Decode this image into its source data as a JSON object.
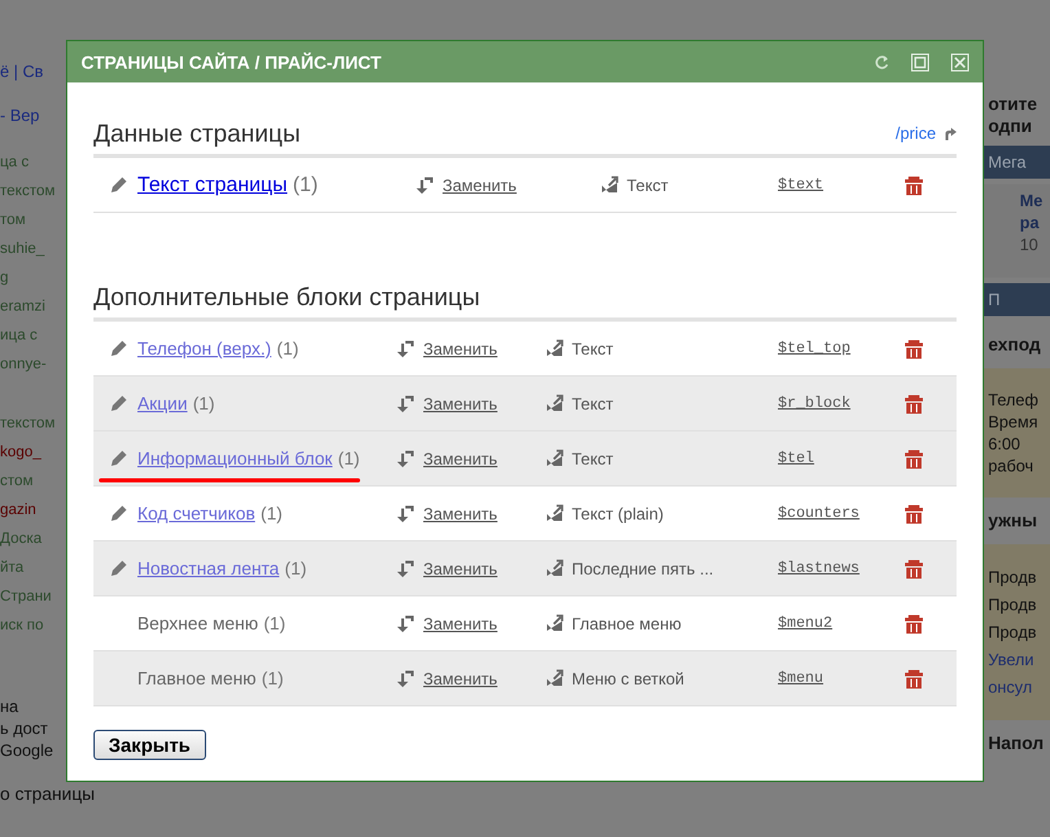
{
  "background": {
    "left": [
      {
        "text": "ё | Св",
        "kind": "link"
      },
      {
        "text": "- Вер",
        "kind": "link"
      },
      {
        "text": "ца с",
        "kind": "green"
      },
      {
        "text": "текстом",
        "kind": "green"
      },
      {
        "text": "том",
        "kind": "green"
      },
      {
        "text": "suhie_",
        "kind": "green"
      },
      {
        "text": "g",
        "kind": "green"
      },
      {
        "text": "eramzi",
        "kind": "green"
      },
      {
        "text": "ица с",
        "kind": "green"
      },
      {
        "text": "onnye-",
        "kind": "green"
      },
      {
        "kind": "gap"
      },
      {
        "text": "текстом",
        "kind": "green"
      },
      {
        "text": "kogo_",
        "kind": "red"
      },
      {
        "text": "стом",
        "kind": "green"
      },
      {
        "text": "gazin",
        "kind": "red"
      },
      {
        "text": "Доска",
        "kind": "green"
      },
      {
        "text": "йта",
        "kind": "green"
      },
      {
        "text": "Страни",
        "kind": "green"
      },
      {
        "text": "иск по",
        "kind": "green"
      }
    ],
    "left_bottom": [
      "на",
      "ь дост",
      "Google"
    ],
    "left_footer": "о страницы",
    "right": [
      {
        "kind": "title",
        "lines": [
          "отите",
          "одпи"
        ]
      },
      {
        "kind": "band",
        "lines": [
          "Мега"
        ]
      },
      {
        "kind": "promo",
        "lines": [
          "Ме",
          "ра",
          "10"
        ]
      },
      {
        "kind": "band",
        "lines": [
          "П"
        ]
      },
      {
        "kind": "header",
        "lines": [
          "ехпод"
        ]
      },
      {
        "kind": "note",
        "lines": [
          "Телеф",
          "Время",
          "6:00",
          "рабоч"
        ]
      },
      {
        "kind": "header",
        "lines": [
          "ужны"
        ]
      },
      {
        "kind": "list",
        "lines": [
          "Продв",
          "Продв",
          "Продв"
        ],
        "links": [
          "Увели",
          "онсул"
        ]
      },
      {
        "kind": "header",
        "lines": [
          "Напол"
        ]
      }
    ]
  },
  "dialog": {
    "title": "СТРАНИЦЫ САЙТА / ПРАЙС-ЛИСТ",
    "sections": [
      {
        "kind": "main",
        "heading": "Данные страницы",
        "link": "/price",
        "rows": [
          {
            "name": "Текст страницы",
            "count": "(1)",
            "editable": true,
            "shaded": false,
            "annotated": false,
            "action": "Заменить",
            "type": "Текст",
            "variable": "$text"
          }
        ]
      },
      {
        "kind": "extra",
        "heading": "Дополнительные блоки страницы",
        "rows": [
          {
            "name": "Телефон (верх.)",
            "count": "(1)",
            "editable": true,
            "shaded": false,
            "annotated": false,
            "action": "Заменить",
            "type": "Текст",
            "variable": "$tel_top"
          },
          {
            "name": "Акции",
            "count": "(1)",
            "editable": true,
            "shaded": true,
            "annotated": false,
            "action": "Заменить",
            "type": "Текст",
            "variable": "$r_block"
          },
          {
            "name": "Информационный блок",
            "count": "(1)",
            "editable": true,
            "shaded": true,
            "annotated": true,
            "action": "Заменить",
            "type": "Текст",
            "variable": "$tel"
          },
          {
            "name": "Код счетчиков",
            "count": "(1)",
            "editable": true,
            "shaded": false,
            "annotated": false,
            "action": "Заменить",
            "type": "Текст (plain)",
            "variable": "$counters"
          },
          {
            "name": "Новостная лента",
            "count": "(1)",
            "editable": true,
            "shaded": true,
            "annotated": false,
            "action": "Заменить",
            "type": "Последние пять ...",
            "variable": "$lastnews"
          },
          {
            "name": "Верхнее меню",
            "count": "(1)",
            "editable": false,
            "shaded": false,
            "annotated": false,
            "action": "Заменить",
            "type": "Главное меню",
            "variable": "$menu2"
          },
          {
            "name": "Главное меню",
            "count": "(1)",
            "editable": false,
            "shaded": true,
            "annotated": false,
            "action": "Заменить",
            "type": "Меню с веткой",
            "variable": "$menu"
          }
        ]
      }
    ],
    "close_button": "Закрыть"
  }
}
